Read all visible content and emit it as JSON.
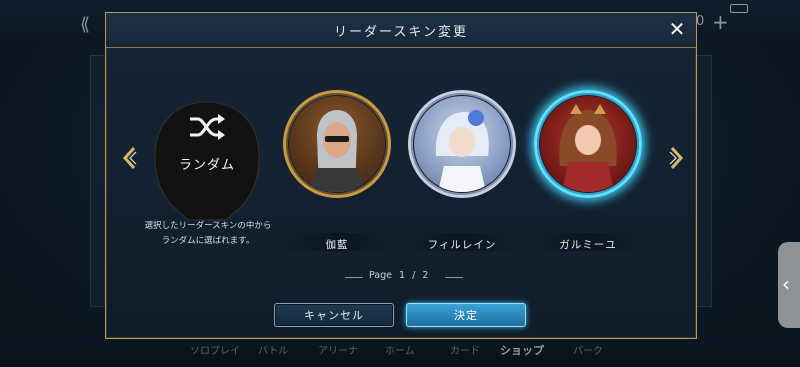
{
  "modal": {
    "title": "リーダースキン変更",
    "close_icon": "close-icon"
  },
  "background": {
    "counter_text": "0",
    "nav_items": [
      "ソロプレイ",
      "バトル",
      "アリーナ",
      "ホーム",
      "カード",
      "ショップ",
      "パーク"
    ],
    "active_nav": "ショップ"
  },
  "random": {
    "label": "ランダム",
    "icon": "shuffle-icon",
    "description_line1": "選択したリーダースキンの中から",
    "description_line2": "ランダムに選ばれます。"
  },
  "characters": [
    {
      "name": "伽藍"
    },
    {
      "name": "フィルレイン"
    },
    {
      "name": "ガルミーユ",
      "selected": true
    }
  ],
  "pagination": {
    "label": "Page",
    "current": "1",
    "separator": "/",
    "total": "2"
  },
  "buttons": {
    "cancel_label": "キャンセル",
    "ok_label": "決定"
  },
  "colors": {
    "accent_gold": "#b89a5e",
    "selected_glow": "#41c7f2",
    "ok_button": "#2a8fc4"
  }
}
